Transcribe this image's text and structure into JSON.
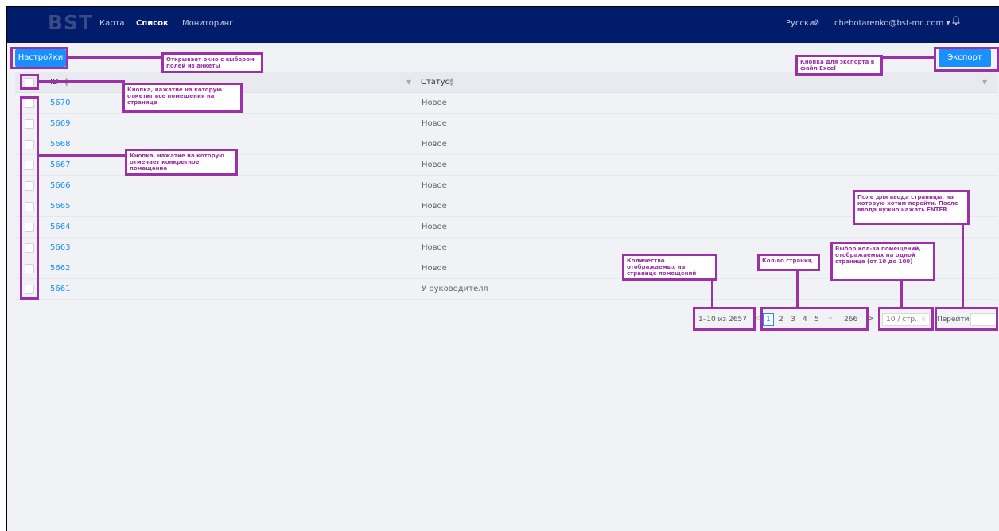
{
  "nav": {
    "logo": "BST",
    "items": [
      "Карта",
      "Список",
      "Мониторинг"
    ],
    "language": "Русский",
    "user": "chebotarenko@bst-mc.com ▾"
  },
  "toolbar": {
    "settings_label": "Настройки",
    "export_label": "Экспорт"
  },
  "table": {
    "columns": [
      "ID",
      "Статус"
    ],
    "rows": [
      {
        "id": "5670",
        "status": "Новое"
      },
      {
        "id": "5669",
        "status": "Новое"
      },
      {
        "id": "5668",
        "status": "Новое"
      },
      {
        "id": "5667",
        "status": "Новое"
      },
      {
        "id": "5666",
        "status": "Новое"
      },
      {
        "id": "5665",
        "status": "Новое"
      },
      {
        "id": "5664",
        "status": "Новое"
      },
      {
        "id": "5663",
        "status": "Новое"
      },
      {
        "id": "5662",
        "status": "Новое"
      },
      {
        "id": "5661",
        "status": "У руководителя"
      }
    ]
  },
  "pagination": {
    "range": "1–10 из 2657",
    "pages": [
      "1",
      "2",
      "3",
      "4",
      "5"
    ],
    "ellipsis": "···",
    "last_page": "266",
    "page_size": "10 / стр.",
    "goto_label": "Перейти",
    "prev": "<",
    "next": ">"
  },
  "annotations": {
    "settings": "Открывает окно с выбором полей из анкеты",
    "export": "Кнопка для экспорта в файл Excel",
    "select_all": "Кнопка, нажатие на которую отметит все помещения на странице",
    "select_row": "Кнопка, нажатие на которую отмечает конкретное помещение",
    "range_count": "Количество отображаемых на странице помещений",
    "pages_count": "Кол-во страниц",
    "page_size": "Выбор кол-ва помещений, отображаемых на одной странице (от 10 до 100)",
    "goto": "Поле для ввода страницы, на которую хотим перейти. После ввода нужно нажать ENTER"
  },
  "colors": {
    "navbar": "#001c6b",
    "primary": "#1890ff",
    "annotation": "#9b30a7",
    "background": "#f0f2f5"
  }
}
